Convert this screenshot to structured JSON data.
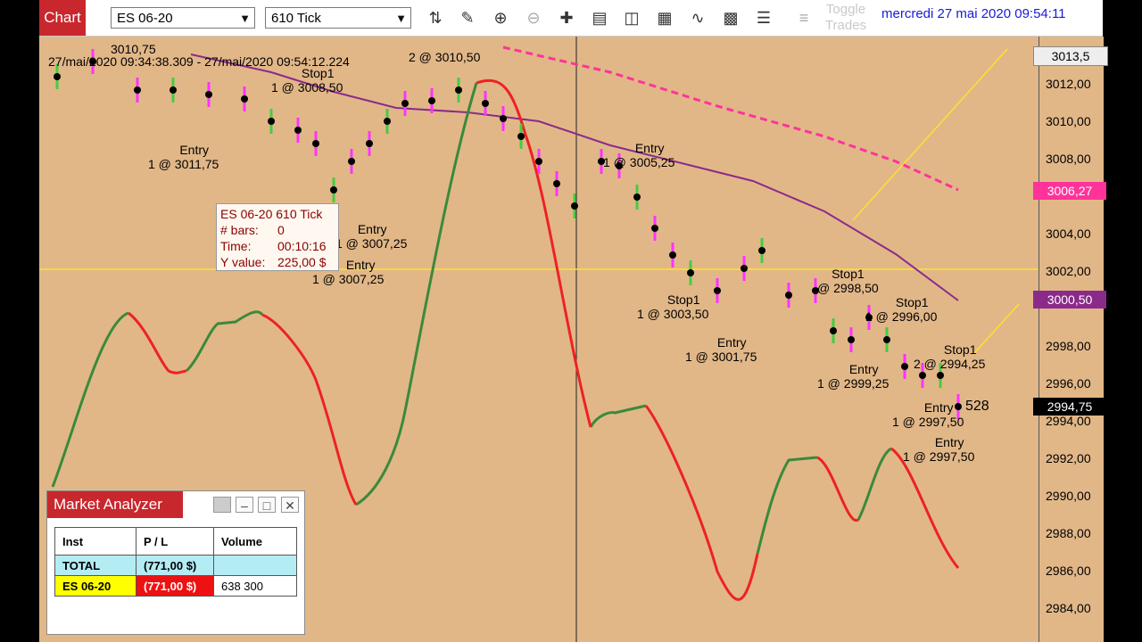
{
  "toolbar": {
    "chart_tab": "Chart",
    "instrument": "ES 06-20",
    "period": "610 Tick",
    "toggle_trades": "Toggle Trades",
    "datetime": "mercredi 27 mai 2020 09:54:11",
    "icons": [
      "bar-type-icon",
      "draw-pen-icon",
      "zoom-in-icon",
      "zoom-out-icon",
      "crosshair-icon",
      "data-box-icon",
      "templates-icon",
      "strategies-icon",
      "indicators-icon",
      "properties-icon",
      "chart-trader-icon",
      "instrument-list-icon"
    ]
  },
  "chart": {
    "axis_labels": [
      "3012,00",
      "3010,00",
      "3008,00",
      "3006,00",
      "3004,00",
      "3002,00",
      "3000,00",
      "2998,00",
      "2996,00",
      "2994,00",
      "2992,00",
      "2990,00",
      "2988,00",
      "2986,00",
      "2984,00"
    ],
    "price_tags": {
      "top": "3013,5",
      "pink": "3006,27",
      "purple": "3000,50",
      "last": "2994,75"
    },
    "colors": {
      "sma_pink": "#ff3399",
      "sma_purple": "#8b2a8b",
      "up_bar": "#44cc44",
      "down_bar": "#ff33ff",
      "osc_up": "#3a8a3a",
      "osc_down": "#ee2222"
    },
    "top_label": "27/mai/2020 09:34:38.309 - 27/mai/2020 09:54:12.224",
    "top_partial": "3010,75",
    "annotations": [
      {
        "id": "a1",
        "line1": "Stop1",
        "line2": "1 @ 3008,50"
      },
      {
        "id": "a2",
        "line1": "2 @ 3010,50",
        "line2": ""
      },
      {
        "id": "a3",
        "line1": "Entry",
        "line2": "1 @ 3011,75"
      },
      {
        "id": "a4",
        "line1": "Entry",
        "line2": "1 @ 3007,25"
      },
      {
        "id": "a5",
        "line1": "Entry",
        "line2": "1 @ 3007,25"
      },
      {
        "id": "a6",
        "line1": "Entry",
        "line2": "1 @ 3005,25"
      },
      {
        "id": "a7",
        "line1": "Stop1",
        "line2": "1 @ 3003,50"
      },
      {
        "id": "a8",
        "line1": "Entry",
        "line2": "1 @ 3001,75"
      },
      {
        "id": "a9",
        "line1": "Stop1",
        "line2": "@ 2998,50"
      },
      {
        "id": "a10",
        "line1": "Stop1",
        "line2": "1 @ 2996,00"
      },
      {
        "id": "a11",
        "line1": "Entry",
        "line2": "1 @ 2999,25"
      },
      {
        "id": "a12",
        "line1": "Stop1",
        "line2": "2 @ 2994,25"
      },
      {
        "id": "a13",
        "line1": "Entry",
        "line2": "1 @ 2997,50"
      },
      {
        "id": "a14",
        "line1": "Entry",
        "line2": "1 @ 2997,50"
      }
    ],
    "tick_count": "528"
  },
  "tooltip": {
    "title": "ES 06-20 610 Tick",
    "bars_label": "# bars:",
    "bars_value": "0",
    "time_label": "Time:",
    "time_value": "00:10:16",
    "y_label": "Y value:",
    "y_value": "225,00 $"
  },
  "market_analyzer": {
    "title": "Market Analyzer",
    "headers": [
      "Inst",
      "P / L",
      "Volume"
    ],
    "rows": [
      {
        "inst": "TOTAL",
        "pl": "(771,00 $)",
        "volume": ""
      },
      {
        "inst": "ES 06-20",
        "pl": "(771,00 $)",
        "volume": "638 300"
      }
    ]
  }
}
